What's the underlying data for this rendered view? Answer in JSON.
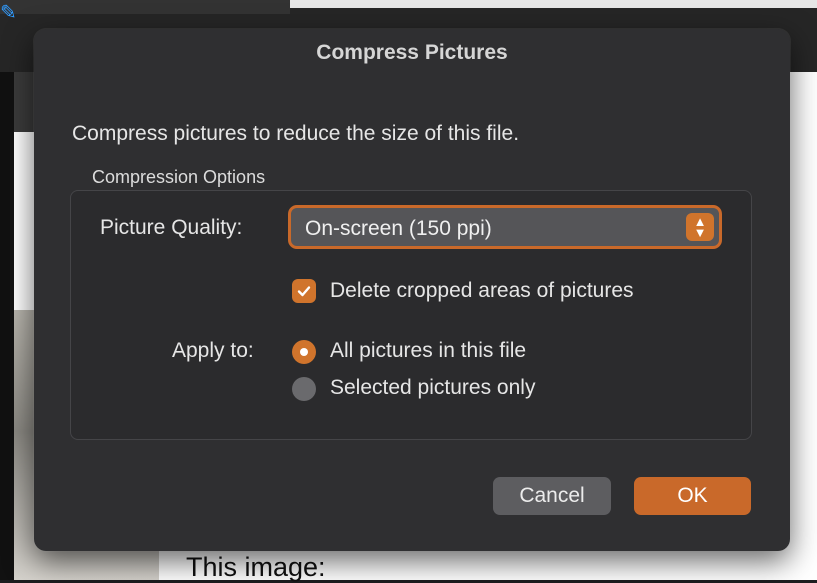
{
  "dialog": {
    "title": "Compress Pictures",
    "description": "Compress pictures to reduce the size of this file.",
    "group_label": "Compression Options",
    "picture_quality": {
      "label": "Picture Quality:",
      "value": "On-screen (150 ppi)"
    },
    "delete_cropped": {
      "label": "Delete cropped areas of pictures",
      "checked": true
    },
    "apply_to": {
      "label": "Apply to:",
      "options": [
        {
          "label": "All pictures in this file",
          "selected": true
        },
        {
          "label": "Selected pictures only",
          "selected": false
        }
      ]
    },
    "buttons": {
      "cancel": "Cancel",
      "ok": "OK"
    }
  },
  "background": {
    "document_text": "This image:"
  },
  "colors": {
    "accent": "#c9692a",
    "dialog_bg": "#2f2f31"
  }
}
